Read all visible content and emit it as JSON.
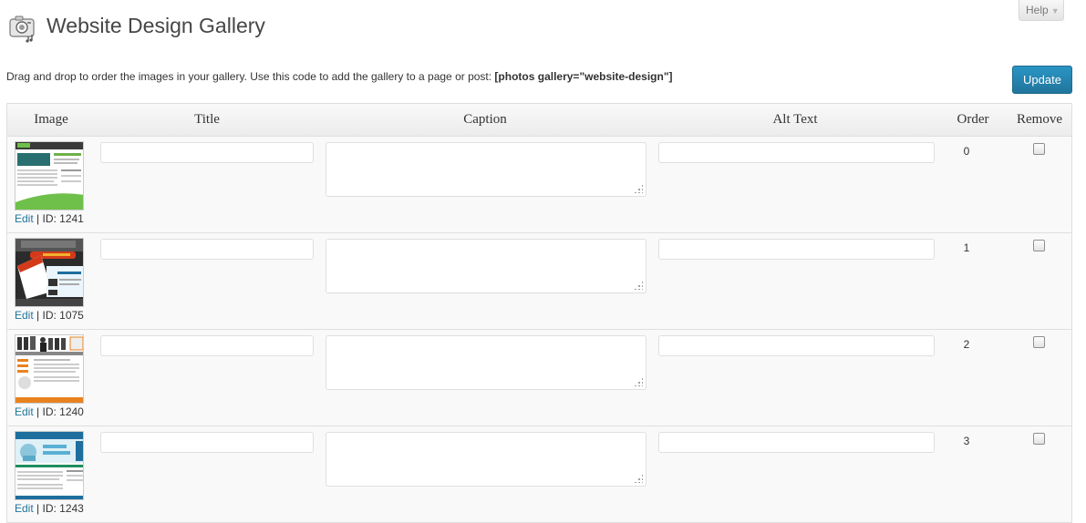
{
  "header": {
    "title": "Website Design Gallery",
    "icon": "photos-gallery-icon",
    "help_label": "Help",
    "help_arrow": "▼"
  },
  "intro": {
    "text": "Drag and drop to order the images in your gallery. Use this code to add the gallery to a page or post: ",
    "code": "[photos gallery=\"website-design\"]"
  },
  "update_label": "Update",
  "columns": {
    "image": "Image",
    "title": "Title",
    "caption": "Caption",
    "alt": "Alt Text",
    "order": "Order",
    "remove": "Remove"
  },
  "rows": [
    {
      "edit": "Edit",
      "id_text": "| ID: 1241",
      "title": "",
      "caption": "",
      "alt": "",
      "order": "0",
      "thumb_color": "#3c9c3c"
    },
    {
      "edit": "Edit",
      "id_text": "| ID: 1075",
      "title": "",
      "caption": "",
      "alt": "",
      "order": "1",
      "thumb_color": "#d43a1a"
    },
    {
      "edit": "Edit",
      "id_text": "| ID: 1240",
      "title": "",
      "caption": "",
      "alt": "",
      "order": "2",
      "thumb_color": "#e8821e"
    },
    {
      "edit": "Edit",
      "id_text": "| ID: 1243",
      "title": "",
      "caption": "",
      "alt": "",
      "order": "3",
      "thumb_color": "#1e6e9e"
    }
  ],
  "colors": {
    "accent": "#21759b",
    "table_border": "#dfdfdf"
  }
}
